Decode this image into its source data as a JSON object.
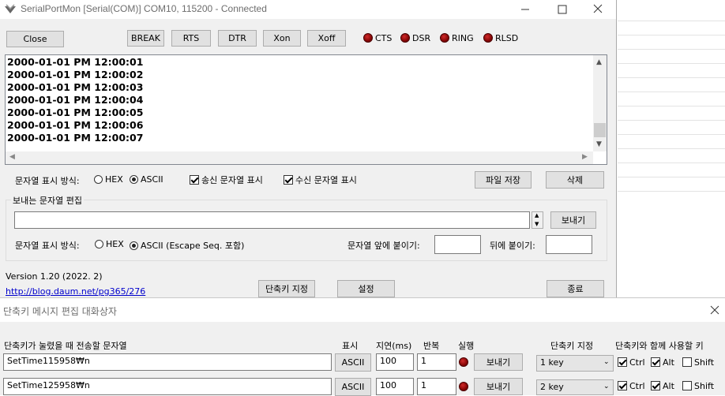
{
  "window": {
    "title": "SerialPortMon [Serial(COM)] COM10, 115200 - Connected"
  },
  "toolbar": {
    "close": "Close",
    "break": "BREAK",
    "rts": "RTS",
    "dtr": "DTR",
    "xon": "Xon",
    "xoff": "Xoff",
    "indicators": [
      "CTS",
      "DSR",
      "RING",
      "RLSD"
    ]
  },
  "log": {
    "lines": [
      "2000-01-01 PM 12:00:01",
      "2000-01-01 PM 12:00:02",
      "2000-01-01 PM 12:00:03",
      "2000-01-01 PM 12:00:04",
      "2000-01-01 PM 12:00:05",
      "2000-01-01 PM 12:00:06",
      "2000-01-01 PM 12:00:07"
    ]
  },
  "display": {
    "label": "문자열 표시 방식:",
    "hex": "HEX",
    "ascii": "ASCII",
    "show_sent": "송신 문자열 표시",
    "show_recv": "수신 문자열 표시",
    "save_file": "파일 저장",
    "delete": "삭제"
  },
  "send": {
    "group_label": "보내는 문자열 편집",
    "input_value": "",
    "send_button": "보내기",
    "mode_label": "문자열 표시 방식:",
    "hex": "HEX",
    "ascii_escape": "ASCII (Escape Seq. 포함)",
    "prefix_label": "문자열 앞에 붙이기:",
    "suffix_label": "뒤에 붙이기:",
    "prefix_value": "",
    "suffix_value": ""
  },
  "footer": {
    "version": "Version 1.20 (2022. 2)",
    "link": "http://blog.daum.net/pg365/276",
    "shortcut": "단축키 지정",
    "settings": "설정",
    "exit": "종료"
  },
  "dialog": {
    "title": "단축키 메시지 편집 대화상자",
    "headers": {
      "message": "단축키가 눌렸을 때 전송할 문자열",
      "display": "표시",
      "delay": "지연(ms)",
      "repeat": "반복",
      "run": "실행",
      "key": "단축키 지정",
      "modifiers": "단축키와 함께 사용할 키"
    },
    "rows": [
      {
        "message": "SetTime115958₩n",
        "display": "ASCII",
        "delay": "100",
        "repeat": "1",
        "send": "보내기",
        "key": "1 key",
        "ctrl": "Ctrl",
        "alt": "Alt",
        "shift": "Shift"
      },
      {
        "message": "SetTime125958₩n",
        "display": "ASCII",
        "delay": "100",
        "repeat": "1",
        "send": "보내기",
        "key": "2 key",
        "ctrl": "Ctrl",
        "alt": "Alt",
        "shift": "Shift"
      }
    ]
  }
}
